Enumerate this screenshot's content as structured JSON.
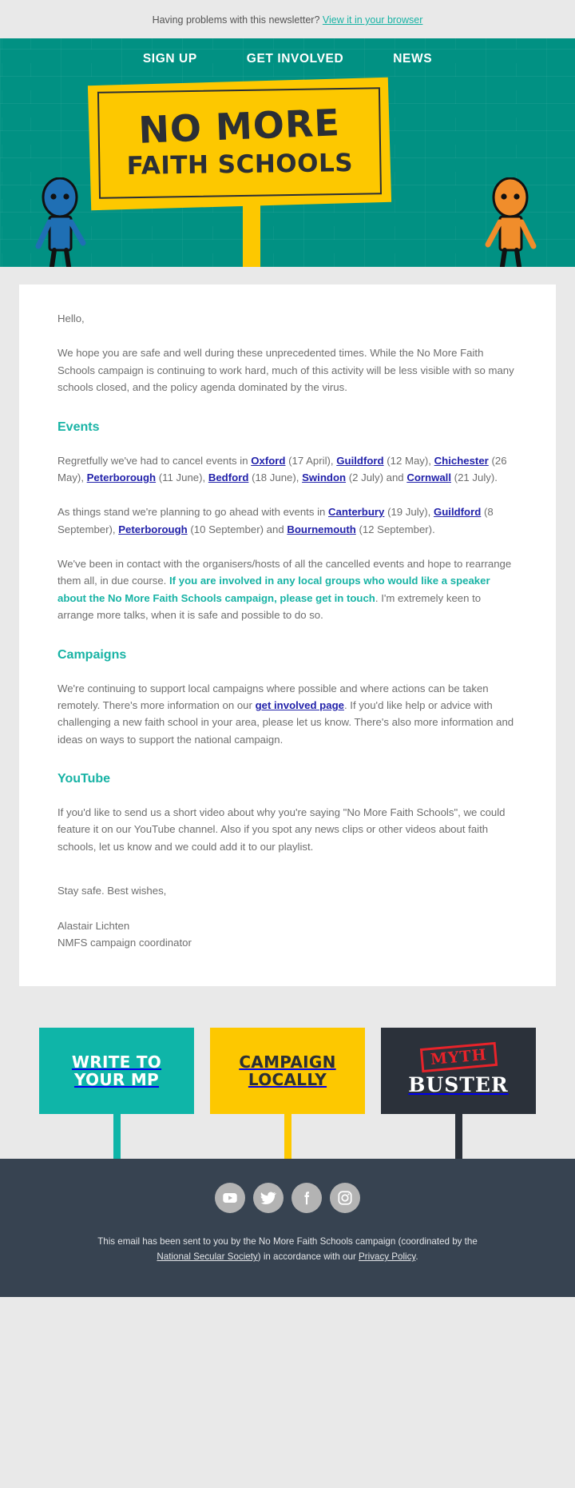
{
  "preheader": {
    "text": "Having problems with this newsletter?",
    "link_label": "View it in your browser"
  },
  "header": {
    "nav": [
      {
        "label": "SIGN UP"
      },
      {
        "label": "GET INVOLVED"
      },
      {
        "label": "NEWS"
      }
    ],
    "placard_line1": "NO MORE",
    "placard_line2": "FAITH SCHOOLS",
    "brand_teal": "#019183",
    "brand_yellow": "#fdc800",
    "figure_left_color": "#1f6fb4",
    "figure_right_color": "#f08d2b"
  },
  "body": {
    "greeting": "Hello,",
    "intro": "We hope you are safe and well during these unprecedented times. While the No More Faith Schools campaign is continuing to work hard, much of this activity will be less visible with so many schools closed, and the policy agenda dominated by the virus.",
    "events_heading": "Events",
    "cancelled": {
      "lead": "Regretfully we've had to cancel events in ",
      "items": [
        {
          "place": "Oxford",
          "date": "(17 April)",
          "sep": ", "
        },
        {
          "place": "Guildford",
          "date": "(12 May)",
          "sep": ", "
        },
        {
          "place": "Chichester",
          "date": "(26 May)",
          "sep": ", "
        },
        {
          "place": "Peterborough",
          "date": "(11 June)",
          "sep": ", "
        },
        {
          "place": "Bedford",
          "date": "(18 June)",
          "sep": ", "
        },
        {
          "place": "Swindon",
          "date": "(2 July)",
          "sep": " and "
        },
        {
          "place": "Cornwall",
          "date": "(21 July)",
          "sep": "."
        }
      ]
    },
    "upcoming": {
      "lead": "As things stand we're planning to go ahead with events in ",
      "items": [
        {
          "place": "Canterbury",
          "date": "(19 July)",
          "sep": ", "
        },
        {
          "place": "Guildford",
          "date": "(8 September)",
          "sep": ", "
        },
        {
          "place": "Peterborough",
          "date": "(10 September)",
          "sep": " and "
        },
        {
          "place": "Bournemouth",
          "date": "(12 September)",
          "sep": "."
        }
      ]
    },
    "speakers": {
      "part1": "We've been in contact with the organisers/hosts of all the cancelled events and hope to rearrange them all, in due course. ",
      "emphasis": "If you are involved in any local groups who would like a speaker about the No More Faith Schools campaign, please get in touch",
      "part2": ". I'm extremely keen to arrange more talks, when it is safe and possible to do so."
    },
    "campaigns_heading": "Campaigns",
    "campaigns": {
      "part1": "We're continuing to support local campaigns where possible and where actions can be taken remotely. There's more information on our ",
      "link": "get involved page",
      "part2": ". If you'd like help or advice with challenging a new faith school in your area, please let us know. There's also more information and ideas on ways to support the national campaign."
    },
    "youtube_heading": "YouTube",
    "youtube": "If you'd like to send us a short video about why you're saying \"No More Faith Schools\", we could feature it on our YouTube channel. Also if you spot any news clips or other videos about faith schools, let us know and we could add it to our playlist.",
    "closing": "Stay safe. Best wishes,",
    "signature_name": "Alastair Lichten",
    "signature_role": "NMFS campaign coordinator"
  },
  "actions": [
    {
      "label": "WRITE TO\nYOUR MP",
      "line1": "WRITE TO",
      "line2": "YOUR MP",
      "color": "#0fb5a8"
    },
    {
      "label": "CAMPAIGN\nLOCALLY",
      "line1": "CAMPAIGN",
      "line2": "LOCALLY",
      "color": "#fdc800"
    },
    {
      "label": "MYTH BUSTER",
      "line1": "MYTH",
      "line2": "BUSTER",
      "color": "#2b313a"
    }
  ],
  "footer": {
    "socials": [
      {
        "name": "youtube-icon"
      },
      {
        "name": "twitter-icon"
      },
      {
        "name": "facebook-icon"
      },
      {
        "name": "instagram-icon"
      }
    ],
    "legal_part1": "This email has been sent to you by the No More Faith Schools campaign (coordinated by the ",
    "legal_link1": "National Secular Society",
    "legal_part2": ") in accordance with our ",
    "legal_link2": "Privacy Policy",
    "legal_part3": "."
  }
}
